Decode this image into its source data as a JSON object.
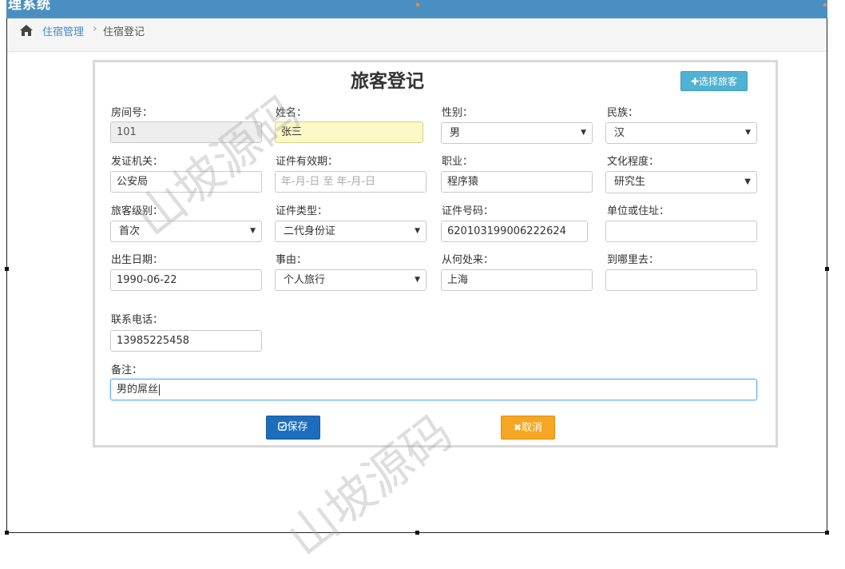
{
  "window": {
    "title": "理系统"
  },
  "breadcrumb": {
    "parent": "住宿管理",
    "separator": "›",
    "current": "住宿登记"
  },
  "form": {
    "title": "旅客登记",
    "select_guest_label": "✚选择旅客",
    "fields": {
      "room_no": {
        "label": "房间号：",
        "value": "101"
      },
      "name": {
        "label": "姓名：",
        "value": "张三"
      },
      "gender": {
        "label": "性别：",
        "value": "男"
      },
      "ethnicity": {
        "label": "民族：",
        "value": "汉"
      },
      "issuer": {
        "label": "发证机关：",
        "value": "公安局"
      },
      "id_validity": {
        "label": "证件有效期：",
        "placeholder": "年-月-日 至 年-月-日"
      },
      "occupation": {
        "label": "职业：",
        "value": "程序猿"
      },
      "education": {
        "label": "文化程度：",
        "value": "研究生"
      },
      "guest_level": {
        "label": "旅客级别：",
        "value": "首次"
      },
      "id_type": {
        "label": "证件类型：",
        "value": "二代身份证"
      },
      "id_number": {
        "label": "证件号码：",
        "value": "620103199006222624"
      },
      "employer_address": {
        "label": "单位或住址：",
        "value": ""
      },
      "birth_date": {
        "label": "出生日期：",
        "value": "1990-06-22"
      },
      "reason": {
        "label": "事由：",
        "value": "个人旅行"
      },
      "came_from": {
        "label": "从何处来：",
        "value": "上海"
      },
      "going_to": {
        "label": "到哪里去：",
        "value": ""
      },
      "phone": {
        "label": "联系电话：",
        "value": "13985225458"
      },
      "remarks": {
        "label": "备注：",
        "value": "男的屌丝"
      }
    },
    "save_label": "保存",
    "cancel_label": "取消"
  },
  "watermark_text": "山坡源码",
  "icons": [
    "home-icon",
    "plus-icon",
    "check-square-icon",
    "close-icon",
    "chevron-down-icon"
  ]
}
